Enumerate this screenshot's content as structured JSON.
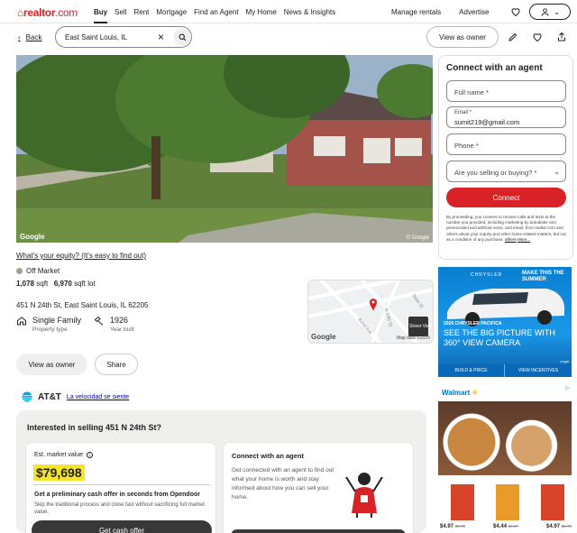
{
  "nav": {
    "logo": "realtor",
    "logo_suffix": ".com",
    "links": [
      "Buy",
      "Sell",
      "Rent",
      "Mortgage",
      "Find an Agent",
      "My Home",
      "News & Insights"
    ],
    "right_links": [
      "Manage rentals",
      "Advertise"
    ]
  },
  "subbar": {
    "back": "Back",
    "search_value": "East Saint Louis, IL",
    "view_as_owner": "View as owner"
  },
  "photo": {
    "watermark_left": "Google",
    "watermark_right": "© Google"
  },
  "property": {
    "equity_link": "What's your equity? (It's easy to find out)",
    "status": "Off Market",
    "sqft": "1,078",
    "sqft_unit": "sqft",
    "lot": "6,970",
    "lot_unit": "sqft lot",
    "address": "451 N 24th St, East Saint Louis, IL 62205",
    "type_value": "Single Family",
    "type_label": "Property type",
    "year_value": "1926",
    "year_label": "Year built"
  },
  "map": {
    "street_view": "Street View",
    "google": "Google",
    "map_data": "Map data ©2025",
    "streets": [
      "State St",
      "N 24th St",
      "Bond Ave"
    ]
  },
  "actions": {
    "view_as_owner": "View as owner",
    "share": "Share"
  },
  "att": {
    "brand": "AT&T",
    "link": "La velocidad se siente"
  },
  "sell": {
    "title": "Interested in selling 451 N 24th St?",
    "emv_label": "Est. market value",
    "price": "$79,698",
    "offer_title": "Get a preliminary cash offer in seconds from Opendoor",
    "offer_desc": "Skip the traditional process and close fast without sacrificing full market value.",
    "cash_cta": "Get cash offer",
    "agent_title": "Connect with an agent",
    "agent_desc": "Get connected with an agent to find out what your home is worth and stay informed about how you can sell your home."
  },
  "agent_form": {
    "title": "Connect with an agent",
    "full_name": "Full name *",
    "email_label": "Email *",
    "email_value": "sumit219@gmail.com",
    "phone": "Phone *",
    "selling": "Are you selling or buying? *",
    "connect": "Connect",
    "legal": "By proceeding, you consent to receive calls and texts at the number you provided, including marketing by autodialer and prerecorded and artificial voice, and email, from realtor.com and others about your inquiry and other home-related matters, but not as a condition of any purchase.",
    "legal_link_others": "others",
    "legal_more": "More..."
  },
  "ad1": {
    "brand": "CHRYSLER",
    "tagline": "MAKE THIS THE SUMMER",
    "model": "2026 CHRYSLER PACIFICA",
    "headline": "SEE THE BIG PICTURE WITH 360° VIEW CAMERA",
    "legal": "Legal",
    "btn1": "BUILD & PRICE",
    "btn2": "VIEW INCENTIVES"
  },
  "ad2": {
    "brand": "Walmart",
    "prices": [
      {
        "now": "$4.97",
        "was": "$5.78"
      },
      {
        "now": "$4.44",
        "was": "$4.97"
      },
      {
        "now": "$4.97",
        "was": "$5.78"
      }
    ]
  },
  "colors": {
    "brand_red": "#d92228",
    "highlight": "#f5e42a"
  }
}
